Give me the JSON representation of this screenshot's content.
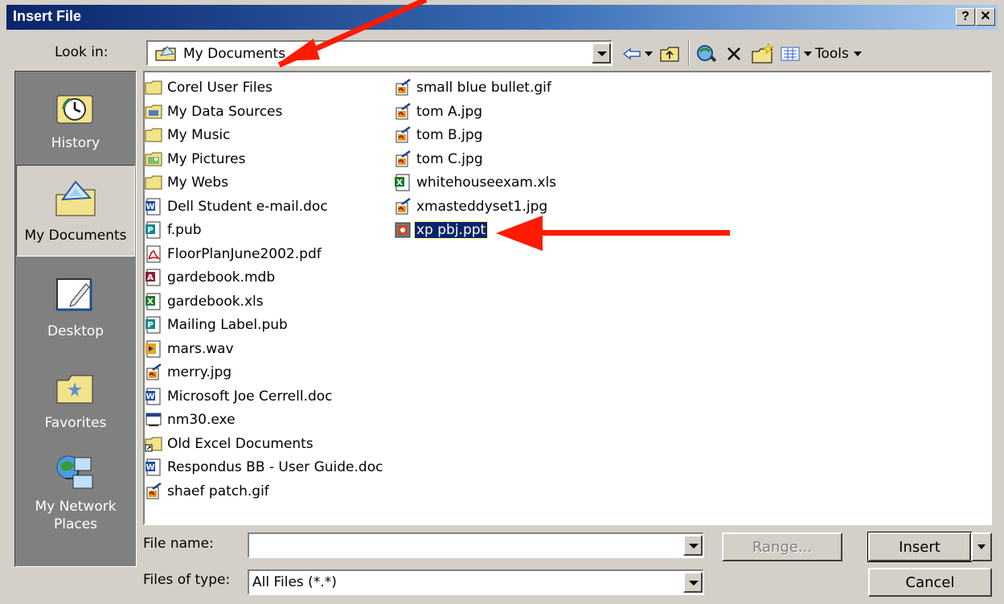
{
  "window": {
    "title": "Insert File",
    "help_glyph": "?",
    "close_glyph": "✕"
  },
  "lookin": {
    "label": "Look in:",
    "value": "My Documents"
  },
  "toolbar": {
    "tools_label": "Tools"
  },
  "places": [
    {
      "label": "History",
      "icon": "history-icon"
    },
    {
      "label": "My Documents",
      "icon": "my-documents-icon",
      "selected": true
    },
    {
      "label": "Desktop",
      "icon": "desktop-icon"
    },
    {
      "label": "Favorites",
      "icon": "favorites-icon"
    },
    {
      "label": "My Network Places",
      "icon": "network-places-icon"
    }
  ],
  "files": [
    {
      "name": "Corel User Files",
      "type": "folder"
    },
    {
      "name": "My Data Sources",
      "type": "folder-data"
    },
    {
      "name": "My Music",
      "type": "folder"
    },
    {
      "name": "My Pictures",
      "type": "folder-pictures"
    },
    {
      "name": "My Webs",
      "type": "folder"
    },
    {
      "name": "Dell Student e-mail.doc",
      "type": "word"
    },
    {
      "name": "f.pub",
      "type": "publisher"
    },
    {
      "name": "FloorPlanJune2002.pdf",
      "type": "pdf"
    },
    {
      "name": "gardebook.mdb",
      "type": "access"
    },
    {
      "name": "gardebook.xls",
      "type": "excel"
    },
    {
      "name": "Mailing Label.pub",
      "type": "publisher"
    },
    {
      "name": "mars.wav",
      "type": "audio"
    },
    {
      "name": "merry.jpg",
      "type": "image"
    },
    {
      "name": "Microsoft Joe Cerrell.doc",
      "type": "word"
    },
    {
      "name": "nm30.exe",
      "type": "exe"
    },
    {
      "name": "Old Excel Documents",
      "type": "folder-shortcut"
    },
    {
      "name": "Respondus BB - User Guide.doc",
      "type": "word"
    },
    {
      "name": "shaef patch.gif",
      "type": "image"
    },
    {
      "name": "small blue bullet.gif",
      "type": "image"
    },
    {
      "name": "tom A.jpg",
      "type": "image"
    },
    {
      "name": "tom B.jpg",
      "type": "image"
    },
    {
      "name": "tom C.jpg",
      "type": "image"
    },
    {
      "name": "whitehouseexam.xls",
      "type": "excel"
    },
    {
      "name": "xmasteddyset1.jpg",
      "type": "image"
    },
    {
      "name": "xp pbj.ppt",
      "type": "powerpoint",
      "selected": true
    }
  ],
  "bottom": {
    "filename_label": "File name:",
    "filename_value": "",
    "filetype_label": "Files of type:",
    "filetype_value": "All Files (*.*)",
    "range_label": "Range...",
    "insert_label": "Insert",
    "cancel_label": "Cancel"
  },
  "colors": {
    "title_start": "#0a246a",
    "selection": "#0a246a",
    "annotation_arrow": "#ff1a00"
  }
}
